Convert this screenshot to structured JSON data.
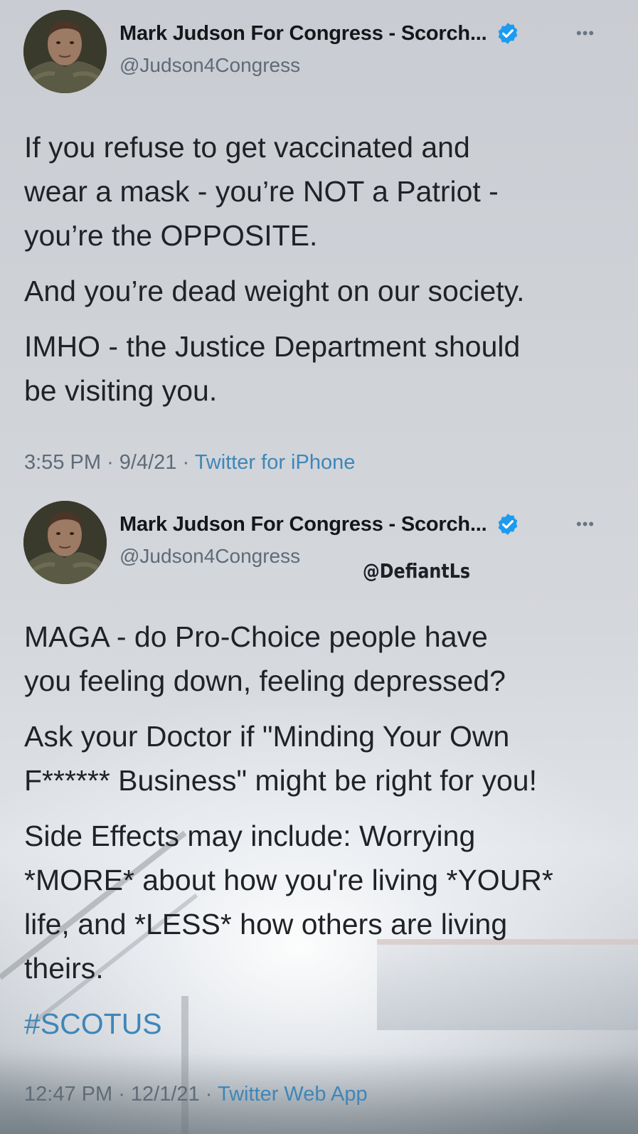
{
  "tweets": [
    {
      "display_name": "Mark Judson For Congress - Scorch...",
      "handle": "@Judson4Congress",
      "more_icon": "more-horizontal-icon",
      "verified_icon": "verified-badge-icon",
      "paragraphs": [
        "If you refuse to get vaccinated and\nwear a mask - you’re NOT a Patriot -\nyou’re the OPPOSITE.",
        "And you’re dead weight on our society.",
        "IMHO - the Justice Department should\nbe visiting you."
      ],
      "time": "3:55 PM",
      "date": "9/4/21",
      "source": "Twitter for iPhone"
    },
    {
      "display_name": "Mark Judson For Congress - Scorch...",
      "handle": "@Judson4Congress",
      "more_icon": "more-horizontal-icon",
      "verified_icon": "verified-badge-icon",
      "paragraphs": [
        "MAGA - do Pro-Choice people have\nyou feeling down, feeling depressed?",
        "Ask your Doctor if \"Minding Your Own\nF****** Business\" might be right for you!",
        "Side Effects may include:  Worrying\n*MORE* about how you're living *YOUR*\nlife, and *LESS* how others are living\ntheirs."
      ],
      "hashtag": "#SCOTUS",
      "time": "12:47 PM",
      "date": "12/1/21",
      "source": "Twitter Web App"
    }
  ],
  "watermark": "@DefiantLs",
  "colors": {
    "verified": "#1d9bf0",
    "link": "#3f86b8",
    "secondary_text": "#5f6b77"
  }
}
